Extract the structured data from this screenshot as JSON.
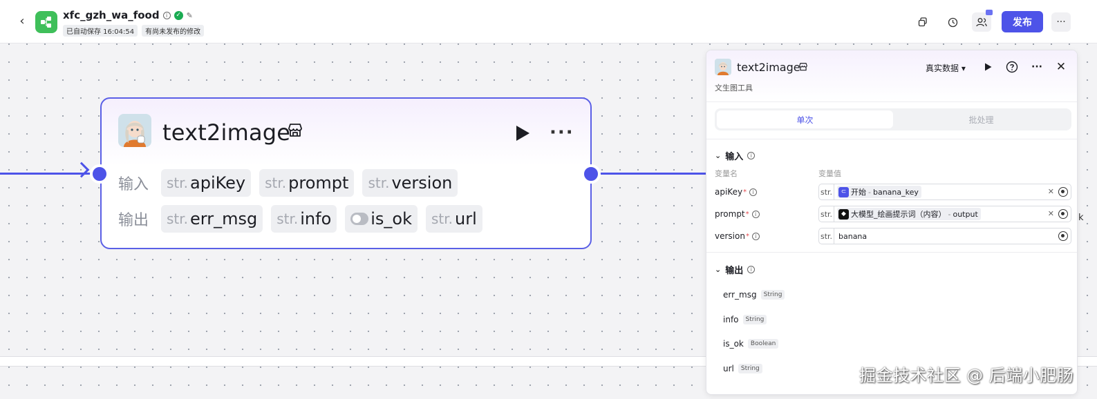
{
  "header": {
    "app_name": "xfc_gzh_wa_food",
    "autosave": "已自动保存 16:04:54",
    "unpublished": "有尚未发布的修改",
    "publish_label": "发布"
  },
  "node": {
    "title": "text2image",
    "input_label": "输入",
    "output_label": "输出",
    "inputs": [
      {
        "type": "str.",
        "name": "apiKey"
      },
      {
        "type": "str.",
        "name": "prompt"
      },
      {
        "type": "str.",
        "name": "version"
      }
    ],
    "outputs": [
      {
        "type": "str.",
        "name": "err_msg"
      },
      {
        "type": "str.",
        "name": "info"
      },
      {
        "type": "toggle",
        "name": "is_ok"
      },
      {
        "type": "str.",
        "name": "url"
      }
    ]
  },
  "panel": {
    "title": "text2image",
    "subtitle": "文生图工具",
    "mode": "真实数据",
    "tabs": [
      {
        "label": "单次",
        "active": true
      },
      {
        "label": "批处理",
        "active": false
      }
    ],
    "input_section": "输入",
    "col_name": "变量名",
    "col_value": "变量值",
    "params": [
      {
        "name": "apiKey",
        "req": "*",
        "type": "str.",
        "ref_source": "开始",
        "ref_sep": " - ",
        "ref_value": "banana_key"
      },
      {
        "name": "prompt",
        "req": "*",
        "type": "str.",
        "ref_source": "大模型_绘画提示词（内容）",
        "ref_sep": " - ",
        "ref_value": "output"
      },
      {
        "name": "version",
        "req": "*",
        "type": "str.",
        "value": "banana"
      }
    ],
    "output_section": "输出",
    "outputs": [
      {
        "name": "err_msg",
        "type": "String"
      },
      {
        "name": "info",
        "type": "String"
      },
      {
        "name": "is_ok",
        "type": "Boolean"
      },
      {
        "name": "url",
        "type": "String"
      }
    ]
  },
  "watermark": "掘金技术社区 @ 后端小肥肠",
  "edge_text": "k",
  "colors": {
    "accent": "#4d53e8",
    "app_icon": "#3fbf5a",
    "verified": "#1aab52"
  }
}
